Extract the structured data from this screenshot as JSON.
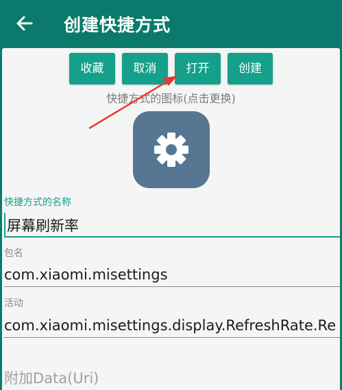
{
  "appbar": {
    "title": "创建快捷方式",
    "back_icon": "arrow-left-icon"
  },
  "toolbar": {
    "favorite_label": "收藏",
    "cancel_label": "取消",
    "open_label": "打开",
    "create_label": "创建"
  },
  "icon_section": {
    "caption": "快捷方式的图标(点击更换)",
    "icon": "gear-icon",
    "icon_bg": "#567692"
  },
  "fields": {
    "shortcut_name": {
      "label": "快捷方式的名称",
      "value": "屏幕刷新率"
    },
    "package": {
      "label": "包名",
      "value": "com.xiaomi.misettings"
    },
    "activity": {
      "label": "活动",
      "value": "com.xiaomi.misettings.display.RefreshRate.Re"
    },
    "extra_data": {
      "placeholder": "附加Data(Uri)"
    }
  },
  "colors": {
    "primary": "#0b7a6c",
    "accent": "#14a08b",
    "annotation_arrow": "#e53935"
  }
}
